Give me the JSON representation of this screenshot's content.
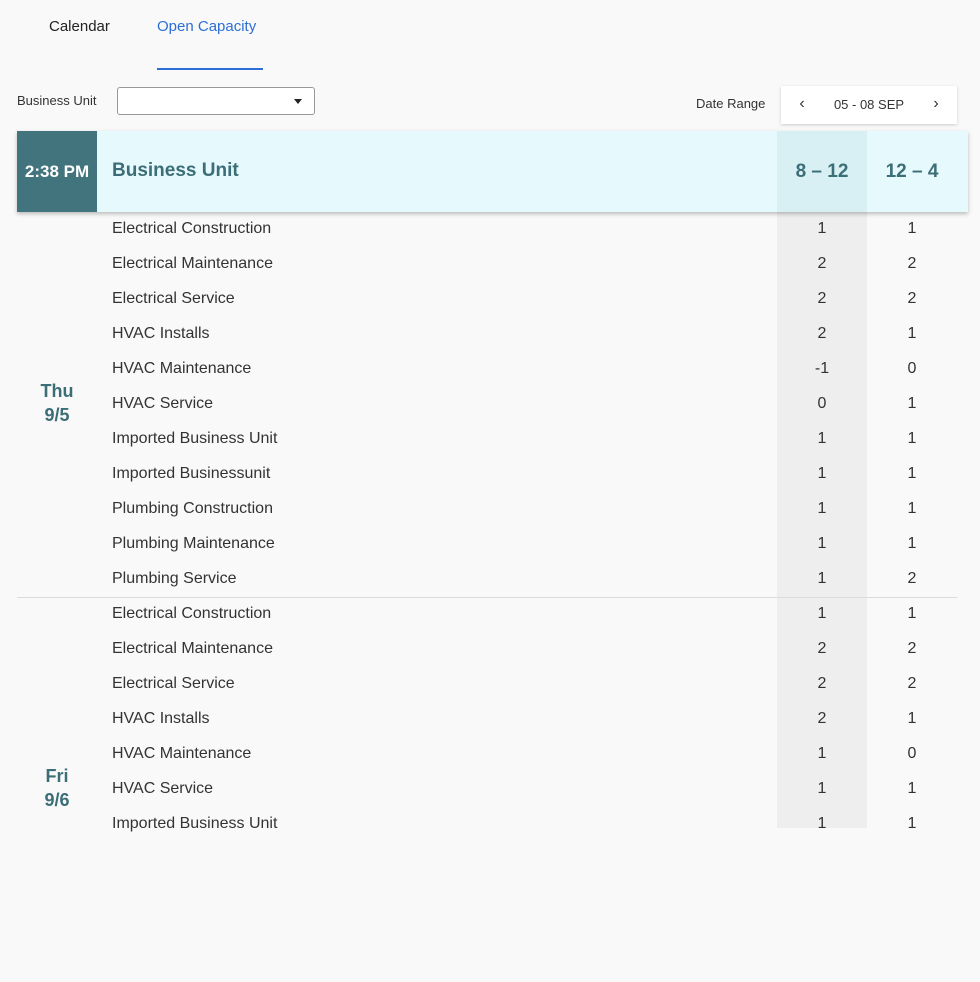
{
  "tabs": {
    "calendar": "Calendar",
    "open_capacity": "Open Capacity"
  },
  "filters": {
    "business_unit_label": "Business Unit",
    "business_unit_value": "",
    "date_range_label": "Date Range",
    "date_range_value": "05 - 08 SEP",
    "prev_icon": "‹",
    "next_icon": "›"
  },
  "table": {
    "time": "2:38 PM",
    "business_unit_header": "Business Unit",
    "slot1": "8 – 12",
    "slot2": "12 – 4"
  },
  "days": [
    {
      "weekday": "Thu",
      "date": "9/5",
      "rows": [
        {
          "name": "Electrical Construction",
          "v1": "1",
          "v2": "1"
        },
        {
          "name": "Electrical Maintenance",
          "v1": "2",
          "v2": "2"
        },
        {
          "name": "Electrical Service",
          "v1": "2",
          "v2": "2"
        },
        {
          "name": "HVAC Installs",
          "v1": "2",
          "v2": "1"
        },
        {
          "name": "HVAC Maintenance",
          "v1": "-1",
          "v2": "0"
        },
        {
          "name": "HVAC Service",
          "v1": "0",
          "v2": "1"
        },
        {
          "name": "Imported Business Unit",
          "v1": "1",
          "v2": "1"
        },
        {
          "name": "Imported Businessunit",
          "v1": "1",
          "v2": "1"
        },
        {
          "name": "Plumbing Construction",
          "v1": "1",
          "v2": "1"
        },
        {
          "name": "Plumbing Maintenance",
          "v1": "1",
          "v2": "1"
        },
        {
          "name": "Plumbing Service",
          "v1": "1",
          "v2": "2"
        }
      ]
    },
    {
      "weekday": "Fri",
      "date": "9/6",
      "rows": [
        {
          "name": "Electrical Construction",
          "v1": "1",
          "v2": "1"
        },
        {
          "name": "Electrical Maintenance",
          "v1": "2",
          "v2": "2"
        },
        {
          "name": "Electrical Service",
          "v1": "2",
          "v2": "2"
        },
        {
          "name": "HVAC Installs",
          "v1": "2",
          "v2": "1"
        },
        {
          "name": "HVAC Maintenance",
          "v1": "1",
          "v2": "0"
        },
        {
          "name": "HVAC Service",
          "v1": "1",
          "v2": "1"
        },
        {
          "name": "Imported Business Unit",
          "v1": "1",
          "v2": "1"
        }
      ]
    }
  ]
}
